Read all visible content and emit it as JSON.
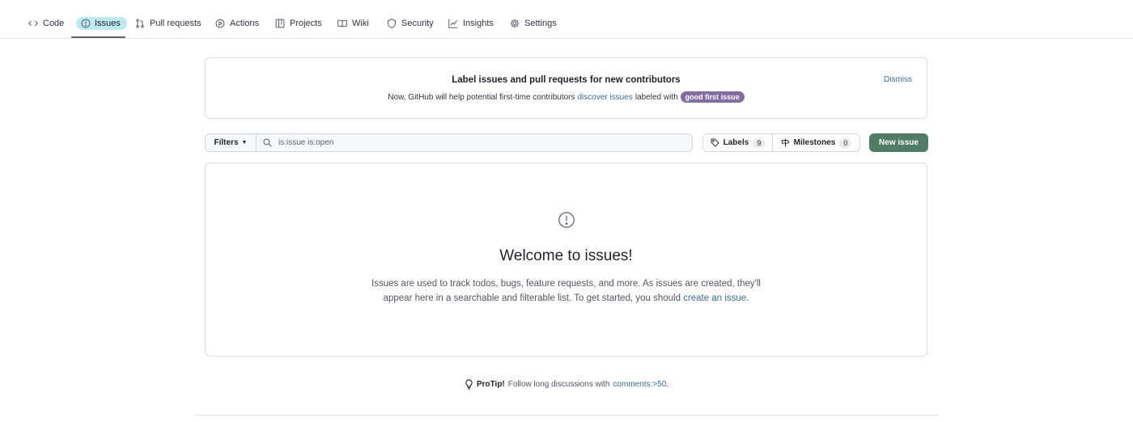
{
  "nav": {
    "items": [
      {
        "label": "Code",
        "icon": "code-icon"
      },
      {
        "label": "Issues",
        "icon": "issue-opened-icon",
        "selected": true
      },
      {
        "label": "Pull requests",
        "icon": "pull-request-icon"
      },
      {
        "label": "Actions",
        "icon": "play-icon"
      },
      {
        "label": "Projects",
        "icon": "table-icon"
      },
      {
        "label": "Wiki",
        "icon": "book-icon"
      },
      {
        "label": "Security",
        "icon": "shield-icon"
      },
      {
        "label": "Insights",
        "icon": "graph-icon"
      },
      {
        "label": "Settings",
        "icon": "gear-icon"
      }
    ]
  },
  "banner": {
    "title": "Label issues and pull requests for new contributors",
    "text_before": "Now, GitHub will help potential first-time contributors",
    "link": "discover issues",
    "text_after": "labeled with",
    "label": "good first issue",
    "dismiss": "Dismiss"
  },
  "toolbar": {
    "filters": "Filters",
    "search_value": "is:issue is:open",
    "labels": "Labels",
    "labels_count": "9",
    "milestones": "Milestones",
    "milestones_count": "0",
    "new_issue": "New issue"
  },
  "blankslate": {
    "title": "Welcome to issues!",
    "desc_before": "Issues are used to track todos, bugs, feature requests, and more. As issues are created, they'll appear here in a searchable and filterable list. To get started, you should",
    "desc_link": "create an issue",
    "desc_after": "."
  },
  "protip": {
    "strong": "ProTip!",
    "text": "Follow long discussions with",
    "link": "comments:>50",
    "after": "."
  },
  "colors": {
    "accent_link": "#3c6c8e",
    "primary_button": "#4f7c62",
    "label_chip": "#7f6fa3",
    "selected_highlight": "#bfe9f1"
  }
}
